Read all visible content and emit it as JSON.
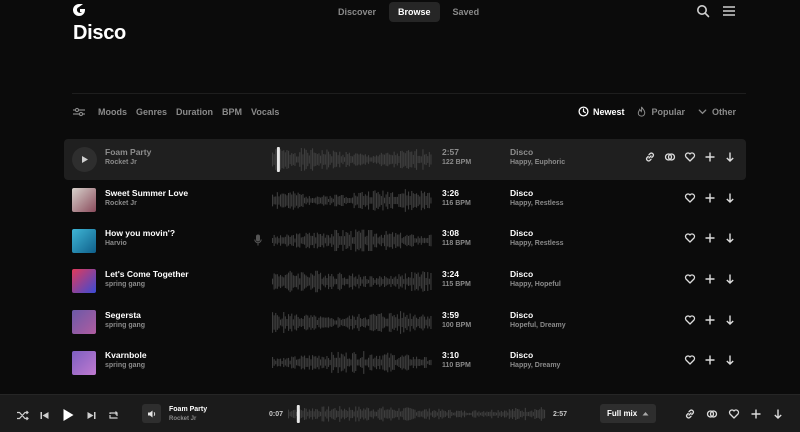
{
  "nav": {
    "tabs": [
      {
        "label": "Discover",
        "active": false
      },
      {
        "label": "Browse",
        "active": true
      },
      {
        "label": "Saved",
        "active": false
      }
    ],
    "icons": [
      "search-icon",
      "menu-icon"
    ]
  },
  "page": {
    "title": "Disco"
  },
  "filters": {
    "icon": "sliders-icon",
    "items": [
      "Moods",
      "Genres",
      "Duration",
      "BPM",
      "Vocals"
    ]
  },
  "sort": {
    "newest": "Newest",
    "popular": "Popular",
    "other": "Other"
  },
  "tracks": [
    {
      "title": "Foam Party",
      "artist": "Rocket Jr",
      "duration": "2:57",
      "bpm": "122 BPM",
      "genre": "Disco",
      "moods": "Happy, Euphoric",
      "active": true,
      "vocals": false,
      "thumb": [
        "#2e2e2e",
        "#2e2e2e"
      ]
    },
    {
      "title": "Sweet Summer Love",
      "artist": "Rocket Jr",
      "duration": "3:26",
      "bpm": "116 BPM",
      "genre": "Disco",
      "moods": "Happy, Restless",
      "active": false,
      "vocals": false,
      "thumb": [
        "#d7d2cc",
        "#8a4b5c"
      ]
    },
    {
      "title": "How you movin'?",
      "artist": "Harvio",
      "duration": "3:08",
      "bpm": "118 BPM",
      "genre": "Disco",
      "moods": "Happy, Restless",
      "active": false,
      "vocals": true,
      "thumb": [
        "#3fb6d6",
        "#0f5f8a"
      ]
    },
    {
      "title": "Let's Come Together",
      "artist": "spring gang",
      "duration": "3:24",
      "bpm": "115 BPM",
      "genre": "Disco",
      "moods": "Happy, Hopeful",
      "active": false,
      "vocals": false,
      "thumb": [
        "#e23a5a",
        "#3a4bd6"
      ]
    },
    {
      "title": "Segersta",
      "artist": "spring gang",
      "duration": "3:59",
      "bpm": "100 BPM",
      "genre": "Disco",
      "moods": "Hopeful, Dreamy",
      "active": false,
      "vocals": false,
      "thumb": [
        "#6b5aa8",
        "#b05ca0"
      ]
    },
    {
      "title": "Kvarnbole",
      "artist": "spring gang",
      "duration": "3:10",
      "bpm": "110 BPM",
      "genre": "Disco",
      "moods": "Happy, Dreamy",
      "active": false,
      "vocals": false,
      "thumb": [
        "#7d5fc0",
        "#c07ad0"
      ]
    }
  ],
  "player": {
    "title": "Foam Party",
    "artist": "Rocket Jr",
    "elapsed": "0:07",
    "total": "2:57",
    "mix_label": "Full mix",
    "progress": 0.04
  },
  "colors": {
    "background": "#0b0b0b",
    "row_active": "#1f1f1f",
    "text_muted": "#8a8a8a"
  }
}
